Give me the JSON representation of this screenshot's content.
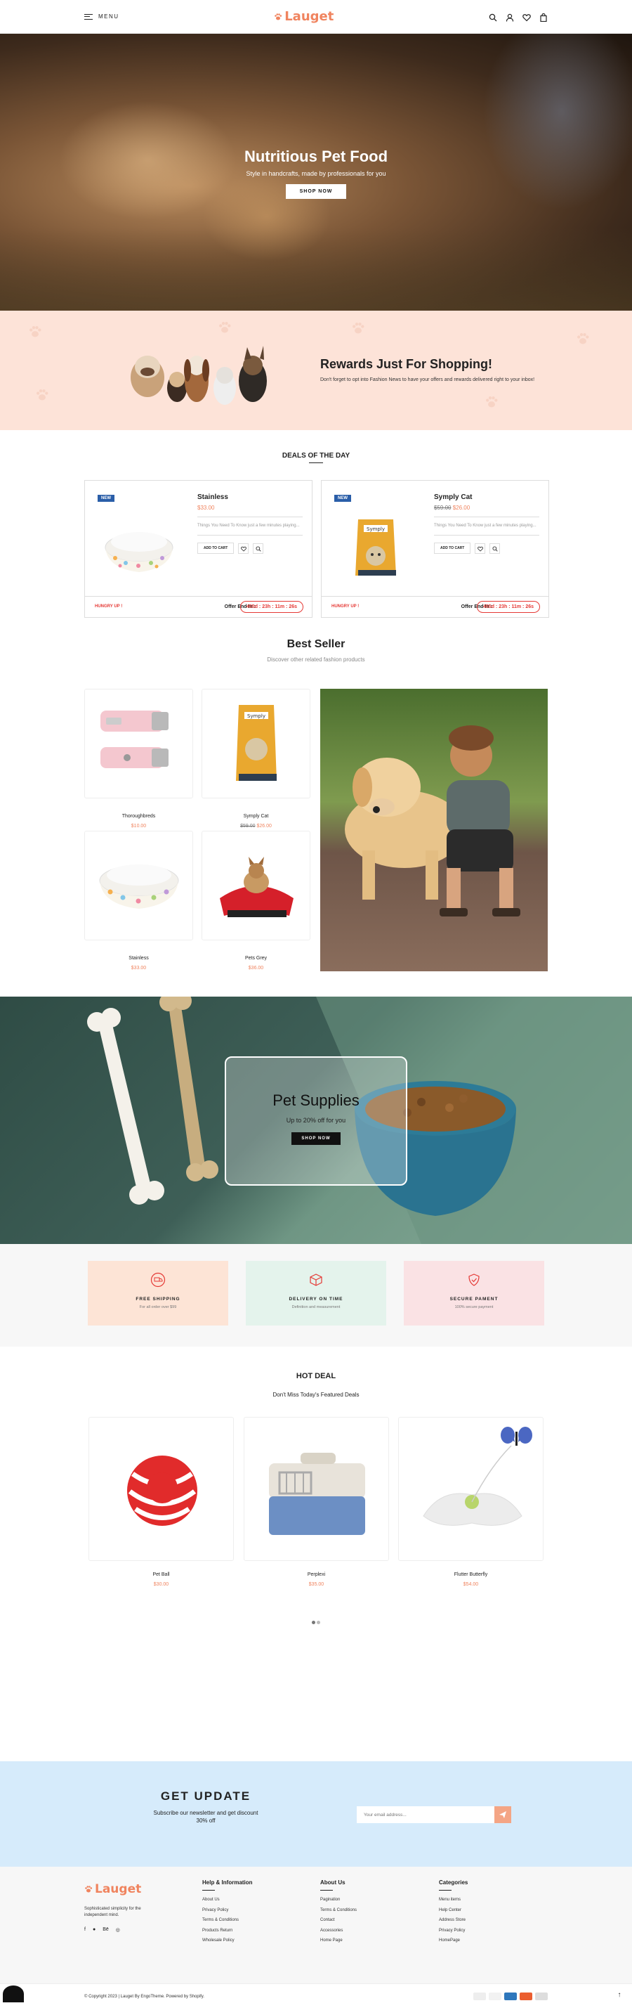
{
  "header": {
    "menu_label": "MENU",
    "logo": "Lauget"
  },
  "hero": {
    "title": "Nutritious Pet Food",
    "subtitle": "Style in handcrafts, made by professionals for you",
    "button": "SHOP NOW"
  },
  "rewards": {
    "title": "Rewards Just For Shopping!",
    "text": "Don't forget to opt into Fashion News to have your offers and rewards delivered right to your inbox!"
  },
  "deals": {
    "title": "DEALS OF THE DAY",
    "items": [
      {
        "badge": "NEW",
        "name": "Stainless",
        "price": "$33.00",
        "old_price": "",
        "desc": "Things You Need To Know just a few minutes playing...",
        "add_to_cart": "ADD TO CART",
        "hungry": "HUNGRY UP !",
        "offer_label": "Offer End In :",
        "timer": "455d : 23h : 11m : 26s"
      },
      {
        "badge": "NEW",
        "name": "Symply Cat",
        "price": "$26.00",
        "old_price": "$59.00",
        "desc": "Things You Need To Know just a few minutes playing...",
        "add_to_cart": "ADD TO CART",
        "hungry": "HUNGRY UP !",
        "offer_label": "Offer End In :",
        "timer": "455d : 23h : 11m : 26s"
      }
    ]
  },
  "best_seller": {
    "title": "Best Seller",
    "subtitle": "Discover other related fashion products",
    "products": [
      {
        "name": "Thoroughbreds",
        "price": "$10.00",
        "old_price": ""
      },
      {
        "name": "Symply Cat",
        "price": "$26.00",
        "old_price": "$59.00"
      },
      {
        "name": "Stainless",
        "price": "$33.00",
        "old_price": ""
      },
      {
        "name": "Pets Grey",
        "price": "$36.00",
        "old_price": ""
      }
    ]
  },
  "supplies": {
    "title": "Pet Supplies",
    "subtitle": "Up to 20% off for you",
    "button": "SHOP NOW"
  },
  "features": [
    {
      "title": "FREE SHIPPING",
      "text": "For all order over $99",
      "color": "#fde4d6",
      "icon": "truck-icon"
    },
    {
      "title": "DELIVERY ON TIME",
      "text": "Definition and measurement",
      "color": "#e4f3ec",
      "icon": "box-icon"
    },
    {
      "title": "SECURE PAMENT",
      "text": "100% secure payment",
      "color": "#fae2e4",
      "icon": "shield-icon"
    }
  ],
  "hot_deal": {
    "title": "HOT DEAL",
    "subtitle": "Don't Miss Today's Featured Deals",
    "products": [
      {
        "name": "Pet Ball",
        "price": "$30.00"
      },
      {
        "name": "Perplexi",
        "price": "$35.00"
      },
      {
        "name": "Flutter Butterfly",
        "price": "$54.00"
      }
    ]
  },
  "newsletter": {
    "title": "GET UPDATE",
    "text": "Subscribe our newsletter and get discount 30% off",
    "placeholder": "Your email address..."
  },
  "footer": {
    "logo": "Lauget",
    "desc": "Sophisticated simplicity for the independent mind.",
    "social": [
      "f-icon",
      "p-icon",
      "be-icon",
      "ig-icon"
    ],
    "columns": [
      {
        "title": "Help & Information",
        "links": [
          "About Us",
          "Privacy Policy",
          "Terms & Conditions",
          "Products Return",
          "Wholesale Policy"
        ]
      },
      {
        "title": "About Us",
        "links": [
          "Pagination",
          "Terms & Conditions",
          "Contact",
          "Accessories",
          "Home Page"
        ]
      },
      {
        "title": "Categories",
        "links": [
          "Menu items",
          "Help Center",
          "Address Store",
          "Privacy Policy",
          "HomePage"
        ]
      }
    ],
    "copyright": "© Copyright 2023 | Lauget By EngoTheme. Powered by Shopify."
  },
  "colors": {
    "accent": "#f0845f",
    "red": "#e53935",
    "navy": "#2a5ea8"
  }
}
